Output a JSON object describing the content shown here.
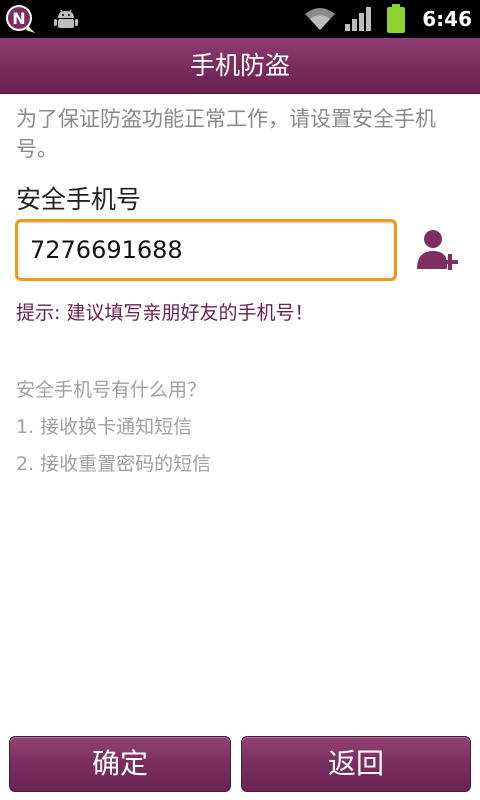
{
  "status_bar": {
    "time": "6:46",
    "icons": [
      "n-logo-icon",
      "android-debug-icon",
      "wifi-icon",
      "signal-icon",
      "battery-icon"
    ],
    "n_logo_letter": "N"
  },
  "header": {
    "title": "手机防盗"
  },
  "main": {
    "intro": "为了保证防盗功能正常工作，请设置安全手机号。",
    "phone_label": "安全手机号",
    "phone_value": "7276691688",
    "contact_button_icon": "add-contact-icon",
    "hint": "提示: 建议填写亲朋好友的手机号！",
    "help": [
      "安全手机号有什么用？",
      "1. 接收换卡通知短信",
      "2. 接收重置密码的短信"
    ]
  },
  "buttons": {
    "confirm": "确定",
    "back": "返回"
  },
  "colors": {
    "brand": "#7a2d5e",
    "input_focus": "#ec9a1f",
    "hint": "#6a1f52"
  }
}
